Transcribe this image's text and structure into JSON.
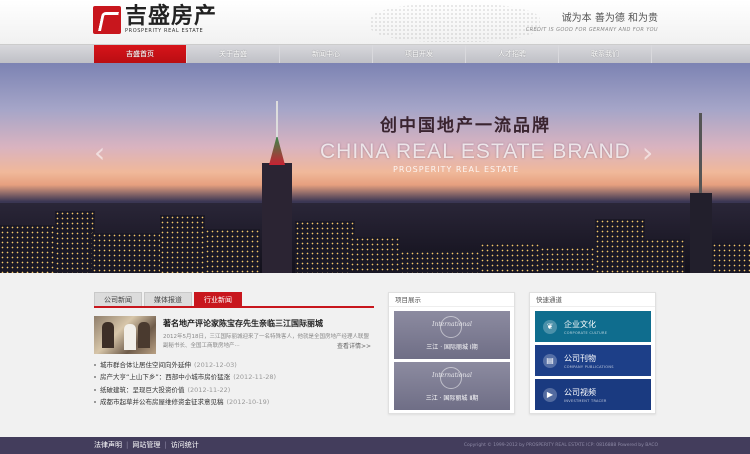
{
  "header": {
    "logo_cn": "吉盛房产",
    "logo_en": "PROSPERITY  REAL ESTATE",
    "slogan_cn": "诚为本 善为德 和为贵",
    "slogan_en": "CREDIT IS GOOD FOR GERMANY AND FOR YOU"
  },
  "nav": {
    "items": [
      "吉盛首页",
      "关于吉盛",
      "新闻中心",
      "项目开发",
      "人才招聘",
      "联系我们"
    ],
    "active_color": "#c8161d"
  },
  "banner": {
    "title_cn": "创中国地产一流品牌",
    "title_en": "CHINA REAL ESTATE BRAND",
    "subtitle": "PROSPERITY REAL ESTATE",
    "prev_icon": "‹",
    "next_icon": "›"
  },
  "news": {
    "tabs": [
      "公司新闻",
      "媒体报道",
      "行业新闻"
    ],
    "featured": {
      "title": "著名地产评论家陈宝存先生亲临三江国际丽城",
      "desc": "2012年5月18日，三江国际丽城迎来了一名特殊客人，他就是全国房地产经理人联盟副秘书长、全国工商联房地产···",
      "more": "查看详情>>"
    },
    "items": [
      {
        "title": "城市群合体让居住空间向外延伸",
        "date": "(2012-12-03)"
      },
      {
        "title": "房产大亨“上山下乡”：西部中小城市房价猛涨",
        "date": "(2012-11-28)"
      },
      {
        "title": "纸破建筑：呈现巨大投资价值",
        "date": "(2012-11-22)"
      },
      {
        "title": "成都市起草并公布房屋维修资金征求意见稿",
        "date": "(2012-10-19)"
      }
    ]
  },
  "projects": {
    "title": "项目展示",
    "items": [
      {
        "logo": "International",
        "label": "三江 · 国际丽城 Ⅰ期"
      },
      {
        "logo": "International",
        "label": "三江 · 国际丽城 Ⅱ期"
      }
    ]
  },
  "quick": {
    "title": "快速通道",
    "items": [
      {
        "cn": "企业文化",
        "en": "CORPORATE CULTURE",
        "color": "#0f6d8e"
      },
      {
        "cn": "公司刊物",
        "en": "COMPANY PUBLICATIONS",
        "color": "#1d3f88"
      },
      {
        "cn": "公司视频",
        "en": "INVESTMENT TRACER",
        "color": "#1a3a80"
      }
    ]
  },
  "footer": {
    "links": [
      "法律声明",
      "网站管理",
      "访问统计"
    ],
    "copyright": "Copyright © 1999-2012 by PROSPERITY REAL ESTATE ICP: 0816888 Powered by BACO"
  }
}
